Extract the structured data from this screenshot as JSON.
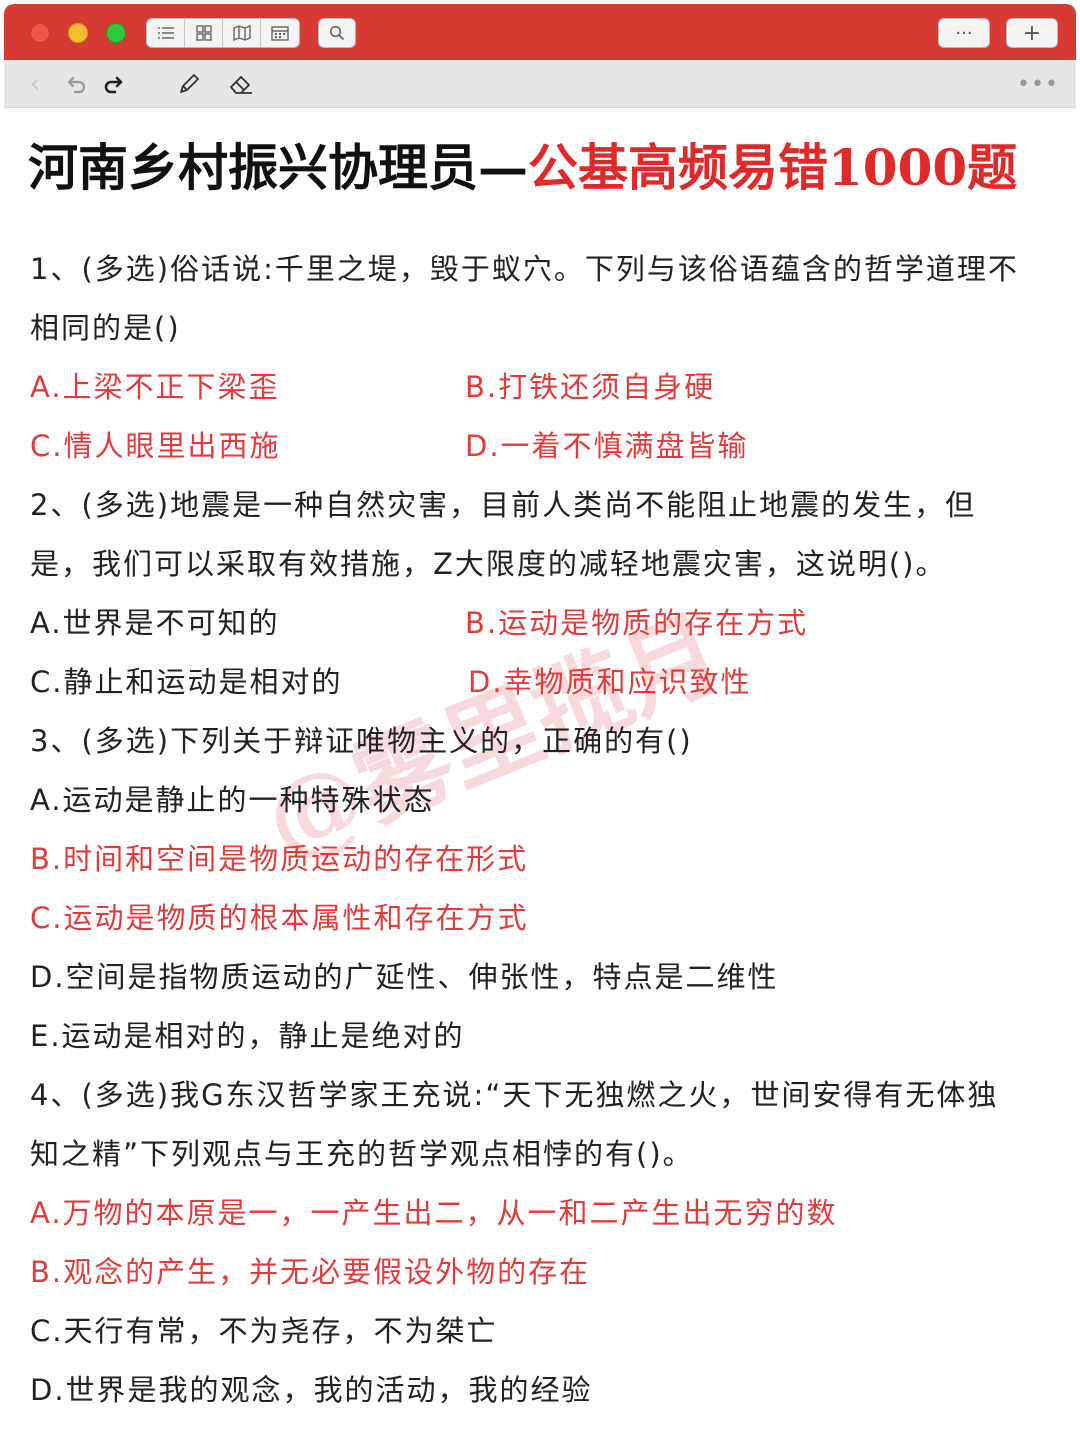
{
  "window": {
    "traffic_lights": [
      "close",
      "minimize",
      "zoom"
    ],
    "view_buttons": [
      "list-icon",
      "grid-icon",
      "map-icon",
      "calendar-icon"
    ],
    "search_icon": "search-icon",
    "more_label": "···",
    "add_label": "+"
  },
  "toolbar": {
    "back_glyph": "‹",
    "undo_glyph": "↶",
    "redo_glyph": "↻",
    "pencil_glyph": "✎",
    "eraser_glyph": "⌫",
    "menu_glyph": "•••"
  },
  "document": {
    "title_black": "河南乡村振兴协理员—",
    "title_red": "公基高频易错1000题",
    "watermark": "@雾里揽月",
    "lines": [
      "1、(多选)俗话说:千里之堤，毁于蚁穴。下列与该俗语蕴含的哲学道理不",
      "相同的是()",
      "2、(多选)地震是一种自然灾害，目前人类尚不能阻止地震的发生，但",
      "是，我们可以采取有效措施，Z大限度的减轻地震灾害，这说明()。",
      "3、(多选)下列关于辩证唯物主义的，正确的有()",
      "A.运动是静止的一种特殊状态",
      "B.时间和空间是物质运动的存在形式",
      "C.运动是物质的根本属性和存在方式",
      "D.空间是指物质运动的广延性、伸张性，特点是二维性",
      "E.运动是相对的，静止是绝对的",
      "4、(多选)我G东汉哲学家王充说:“天下无独燃之火，世间安得有无体独",
      "知之精”下列观点与王充的哲学观点相悖的有()。",
      "A.万物的本原是一，一产生出二，从一和二产生出无穷的数",
      "B.观念的产生，并无必要假设外物的存在",
      "C.天行有常，不为尧存，不为桀亡",
      "D.世界是我的观念，我的活动，我的经验"
    ],
    "options": {
      "q1a": "A.上梁不正下梁歪",
      "q1b": "B.打铁还须自身硬",
      "q1c": "C.情人眼里出西施",
      "q1d": "D.一着不慎满盘皆输",
      "q2a": "A.世界是不可知的",
      "q2b": "B.运动是物质的存在方式",
      "q2c": "C.静止和运动是相对的",
      "q2d": "D.幸物质和应识致性"
    }
  },
  "colors": {
    "titlebar": "#d63a32",
    "answer_red": "#e23b3b",
    "title_red": "#e02a2a",
    "text": "#222222"
  }
}
